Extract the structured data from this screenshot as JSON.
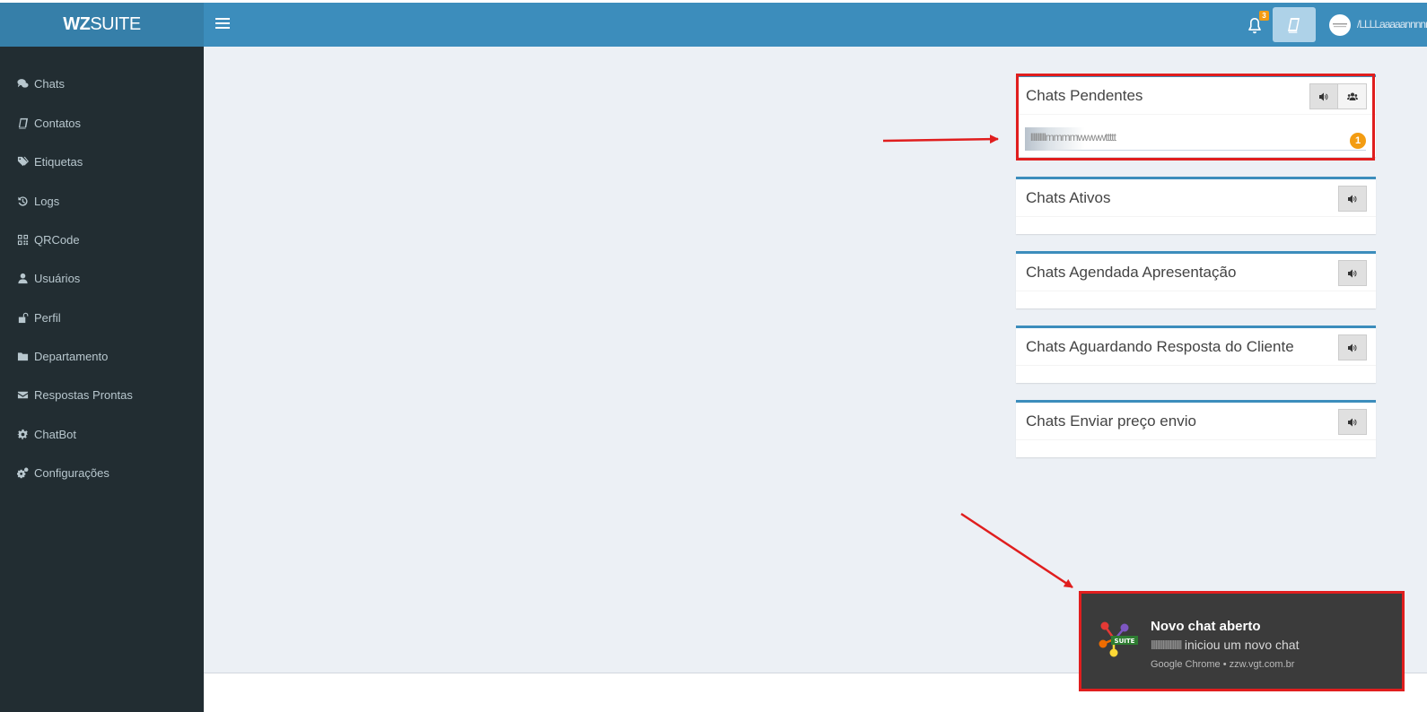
{
  "brand": {
    "logo_bold": "WZ",
    "logo_light": "SUITE"
  },
  "header": {
    "notification_count": "3",
    "username": "/LLLLaaaaannnnn"
  },
  "sidebar": {
    "items": [
      {
        "label": "Chats",
        "icon": "comments-icon"
      },
      {
        "label": "Contatos",
        "icon": "book-icon"
      },
      {
        "label": "Etiquetas",
        "icon": "tags-icon"
      },
      {
        "label": "Logs",
        "icon": "history-icon"
      },
      {
        "label": "QRCode",
        "icon": "qrcode-icon"
      },
      {
        "label": "Usuários",
        "icon": "user-icon"
      },
      {
        "label": "Perfil",
        "icon": "unlock-icon"
      },
      {
        "label": "Departamento",
        "icon": "folder-icon"
      },
      {
        "label": "Respostas Prontas",
        "icon": "envelope-icon"
      },
      {
        "label": "ChatBot",
        "icon": "cog-icon"
      },
      {
        "label": "Configurações",
        "icon": "cogs-icon"
      }
    ]
  },
  "boxes": {
    "pending": {
      "title": "Chats Pendentes",
      "chat_name": "llllllllllmmmmwwwwttttt",
      "count": "1"
    },
    "active": {
      "title": "Chats Ativos"
    },
    "scheduled": {
      "title": "Chats Agendada Apresentação"
    },
    "waiting": {
      "title": "Chats Aguardando Resposta do Cliente"
    },
    "price": {
      "title": "Chats Enviar preço envio"
    }
  },
  "notification": {
    "title": "Novo chat aberto",
    "sender": "lllllllllllllllllllll",
    "message": "iniciou um novo chat",
    "source": "Google Chrome • zzw.vgt.com.br",
    "icon_label": "SUITE"
  },
  "colors": {
    "header": "#3c8dbc",
    "logo_bg": "#367fa9",
    "sidebar": "#222d32",
    "content_bg": "#ecf0f5",
    "annotation": "#e01e1e",
    "badge": "#f39c12"
  }
}
